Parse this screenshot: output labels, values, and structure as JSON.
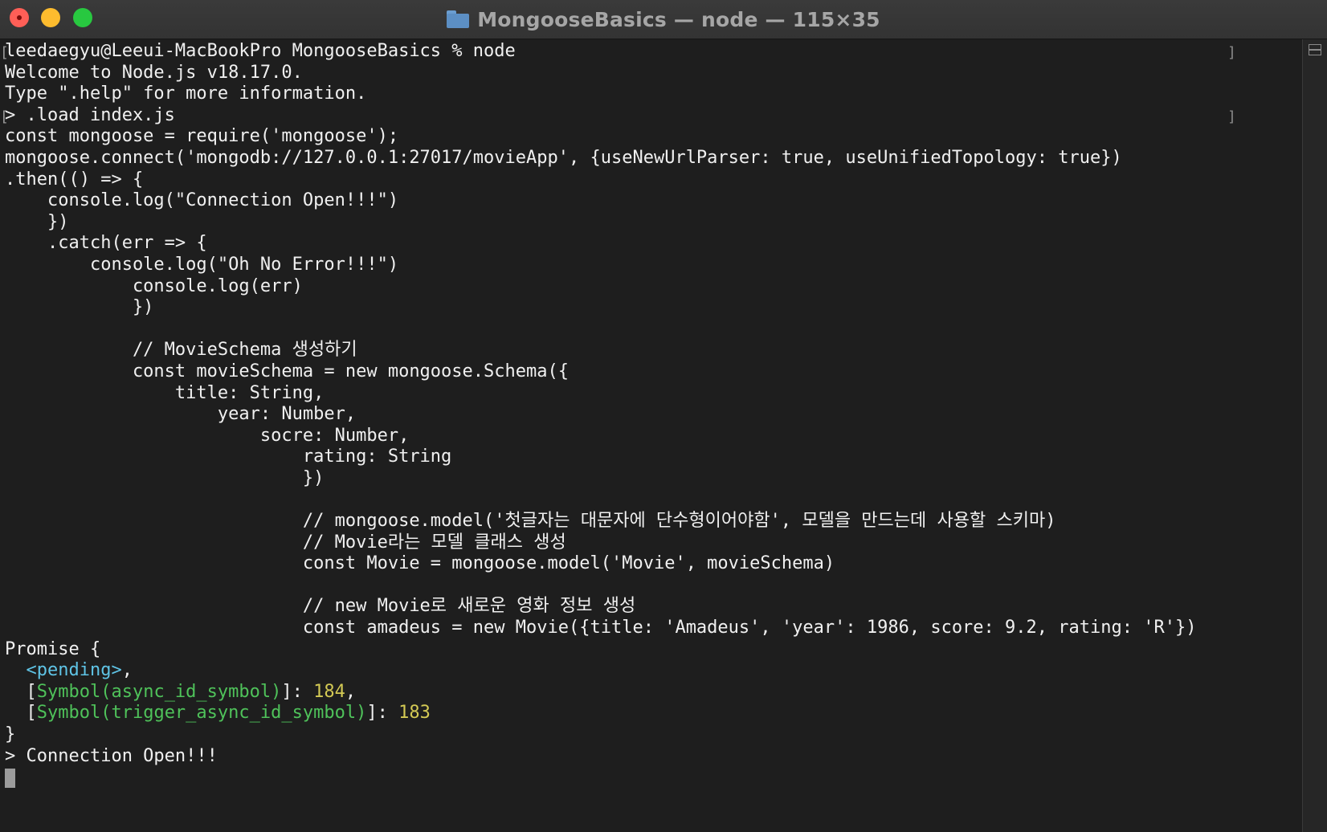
{
  "window": {
    "title": "MongooseBasics — node — 115×35",
    "folder_icon": "folder-icon"
  },
  "colors": {
    "background": "#1e1e1e",
    "text": "#f0f0f0",
    "cyan": "#5fc4e6",
    "green": "#4fc25a",
    "yellow": "#d3c954"
  },
  "terminal": {
    "lines": [
      "leedaegyu@Leeui-MacBookPro MongooseBasics % node",
      "Welcome to Node.js v18.17.0.",
      "Type \".help\" for more information.",
      "> .load index.js",
      "const mongoose = require('mongoose');",
      "mongoose.connect('mongodb://127.0.0.1:27017/movieApp', {useNewUrlParser: true, useUnifiedTopology: true})",
      ".then(() => {",
      "    console.log(\"Connection Open!!!\")",
      "    })",
      "    .catch(err => {",
      "        console.log(\"Oh No Error!!!\")",
      "            console.log(err)",
      "            })",
      "",
      "            // MovieSchema 생성하기",
      "            const movieSchema = new mongoose.Schema({",
      "                title: String,",
      "                    year: Number,",
      "                        socre: Number,",
      "                            rating: String",
      "                            })",
      "",
      "                            // mongoose.model('첫글자는 대문자에 단수형이어야함', 모델을 만드는데 사용할 스키마)",
      "                            // Movie라는 모델 클래스 생성",
      "                            const Movie = mongoose.model('Movie', movieSchema)",
      "",
      "                            // new Movie로 새로운 영화 정보 생성",
      "                            const amadeus = new Movie({title: 'Amadeus', 'year': 1986, score: 9.2, rating: 'R'})",
      "Promise {"
    ],
    "promise": {
      "pending": "<pending>",
      "async_id_label": "Symbol(async_id_symbol)",
      "async_id_value": "184",
      "trigger_id_label": "Symbol(trigger_async_id_symbol)",
      "trigger_id_value": "183",
      "close": "}"
    },
    "last_output": "> Connection Open!!!"
  }
}
